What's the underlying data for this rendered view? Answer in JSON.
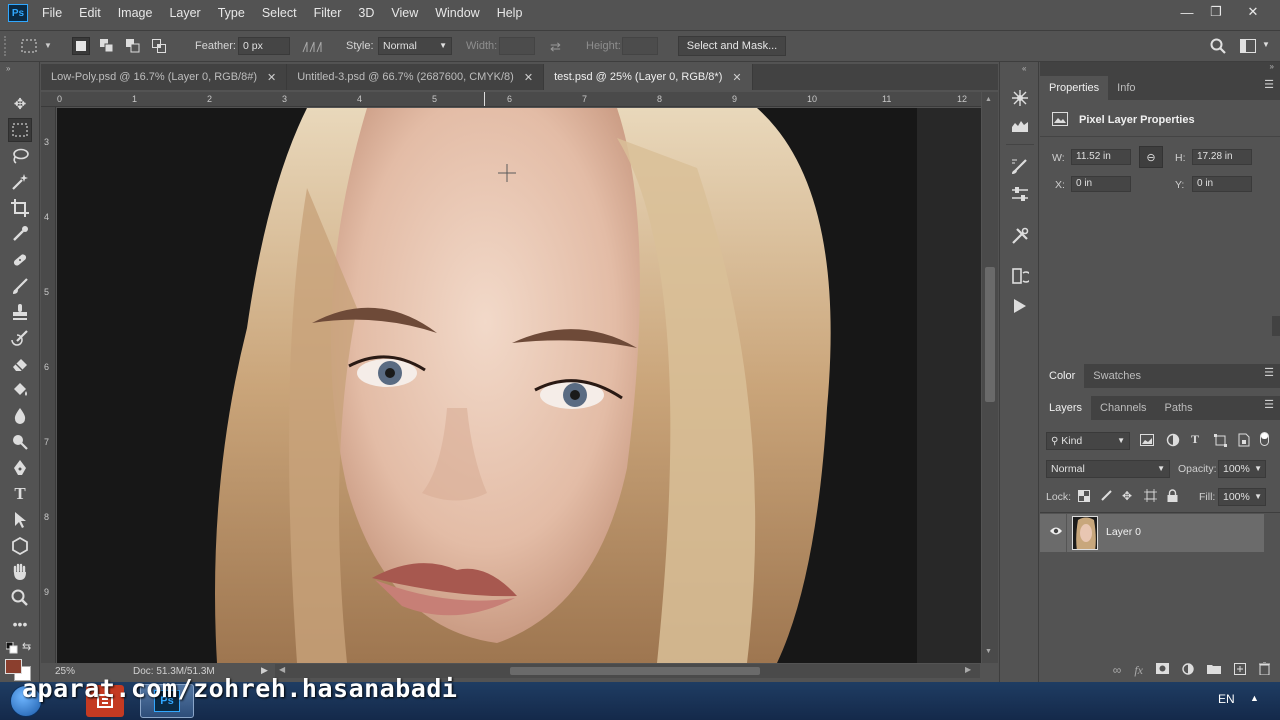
{
  "app": {
    "logo": "Ps",
    "menu": [
      "File",
      "Edit",
      "Image",
      "Layer",
      "Type",
      "Select",
      "Filter",
      "3D",
      "View",
      "Window",
      "Help"
    ]
  },
  "window_controls": {
    "minimize": "—",
    "restore": "❐",
    "close": "✕"
  },
  "options_bar": {
    "feather_label": "Feather:",
    "feather_value": "0 px",
    "style_label": "Style:",
    "style_value": "Normal",
    "width_label": "Width:",
    "height_label": "Height:",
    "select_mask_label": "Select and Mask..."
  },
  "tabs": [
    {
      "label": "Low-Poly.psd @ 16.7% (Layer 0, RGB/8#)",
      "close": "✕"
    },
    {
      "label": "Untitled-3.psd @ 66.7% (2687600, CMYK/8)",
      "close": "✕"
    },
    {
      "label": "test.psd @ 25% (Layer 0, RGB/8*)",
      "close": "✕"
    }
  ],
  "rulers": {
    "horizontal": [
      "0",
      "1",
      "2",
      "3",
      "4",
      "5",
      "6",
      "7",
      "8",
      "9",
      "10",
      "11",
      "12"
    ],
    "vertical": [
      "3",
      "4",
      "5",
      "6",
      "7",
      "8",
      "9"
    ]
  },
  "status": {
    "zoom": "25%",
    "doc": "Doc: 51.3M/51.3M"
  },
  "properties_panel": {
    "tabs": [
      "Properties",
      "Info"
    ],
    "section_title": "Pixel Layer Properties",
    "w_label": "W:",
    "w_value": "11.52 in",
    "h_label": "H:",
    "h_value": "17.28 in",
    "x_label": "X:",
    "x_value": "0 in",
    "y_label": "Y:",
    "y_value": "0 in"
  },
  "color_panel": {
    "tabs": [
      "Color",
      "Swatches"
    ]
  },
  "layers_panel": {
    "tabs": [
      "Layers",
      "Channels",
      "Paths"
    ],
    "filter_kind": "Kind",
    "blend_mode": "Normal",
    "opacity_label": "Opacity:",
    "opacity_value": "100%",
    "lock_label": "Lock:",
    "fill_label": "Fill:",
    "fill_value": "100%",
    "layers": [
      {
        "name": "Layer 0",
        "visible": true
      }
    ]
  },
  "taskbar": {
    "language": "EN",
    "watermark": "aparat.com/zohreh.hasanabadi"
  },
  "colors": {
    "foreground": "#8b3f2e",
    "background": "#ffffff",
    "accent": "#31a8ff"
  }
}
